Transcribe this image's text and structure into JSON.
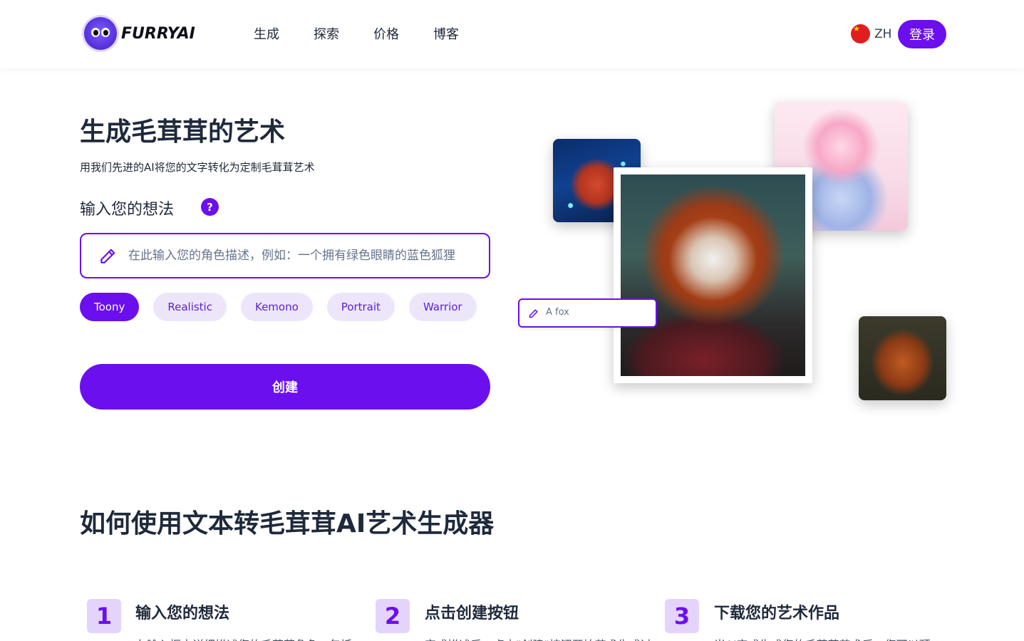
{
  "header": {
    "brand": "FURRYAI",
    "nav": [
      "生成",
      "探索",
      "价格",
      "博客"
    ],
    "lang_code": "ZH",
    "login_label": "登录"
  },
  "hero": {
    "title": "生成毛茸茸的艺术",
    "subtitle": "用我们先进的AI将您的文字转化为定制毛茸茸艺术",
    "idea_label": "输入您的想法",
    "help_symbol": "?",
    "prompt_placeholder": "在此输入您的角色描述，例如：一个拥有绿色眼睛的蓝色狐狸",
    "styles": [
      "Toony",
      "Realistic",
      "Kemono",
      "Portrait",
      "Warrior"
    ],
    "active_style": "Toony",
    "create_label": "创建",
    "example_prompt": "A fox"
  },
  "howto": {
    "title": "如何使用文本转毛茸茸AI艺术生成器",
    "steps": [
      {
        "num": "1",
        "title": "输入您的想法",
        "desc": "在输入框中详细描述您的毛茸茸角色，包括"
      },
      {
        "num": "2",
        "title": "点击创建按钮",
        "desc": "完成描述后，点击\"创建\"按钮开始艺术生成过"
      },
      {
        "num": "3",
        "title": "下载您的艺术作品",
        "desc": "当AI完成生成您的毛茸茸艺术后，您可以预"
      }
    ]
  },
  "colors": {
    "accent": "#6b0fee",
    "chip_bg": "#ede6fb",
    "step_bg": "#e4d4fb",
    "text": "#1e293b"
  },
  "icons": {
    "logo": "fluffy-mascot-icon",
    "flag": "china-flag-icon",
    "pencil": "pencil-icon",
    "help": "question-icon"
  }
}
